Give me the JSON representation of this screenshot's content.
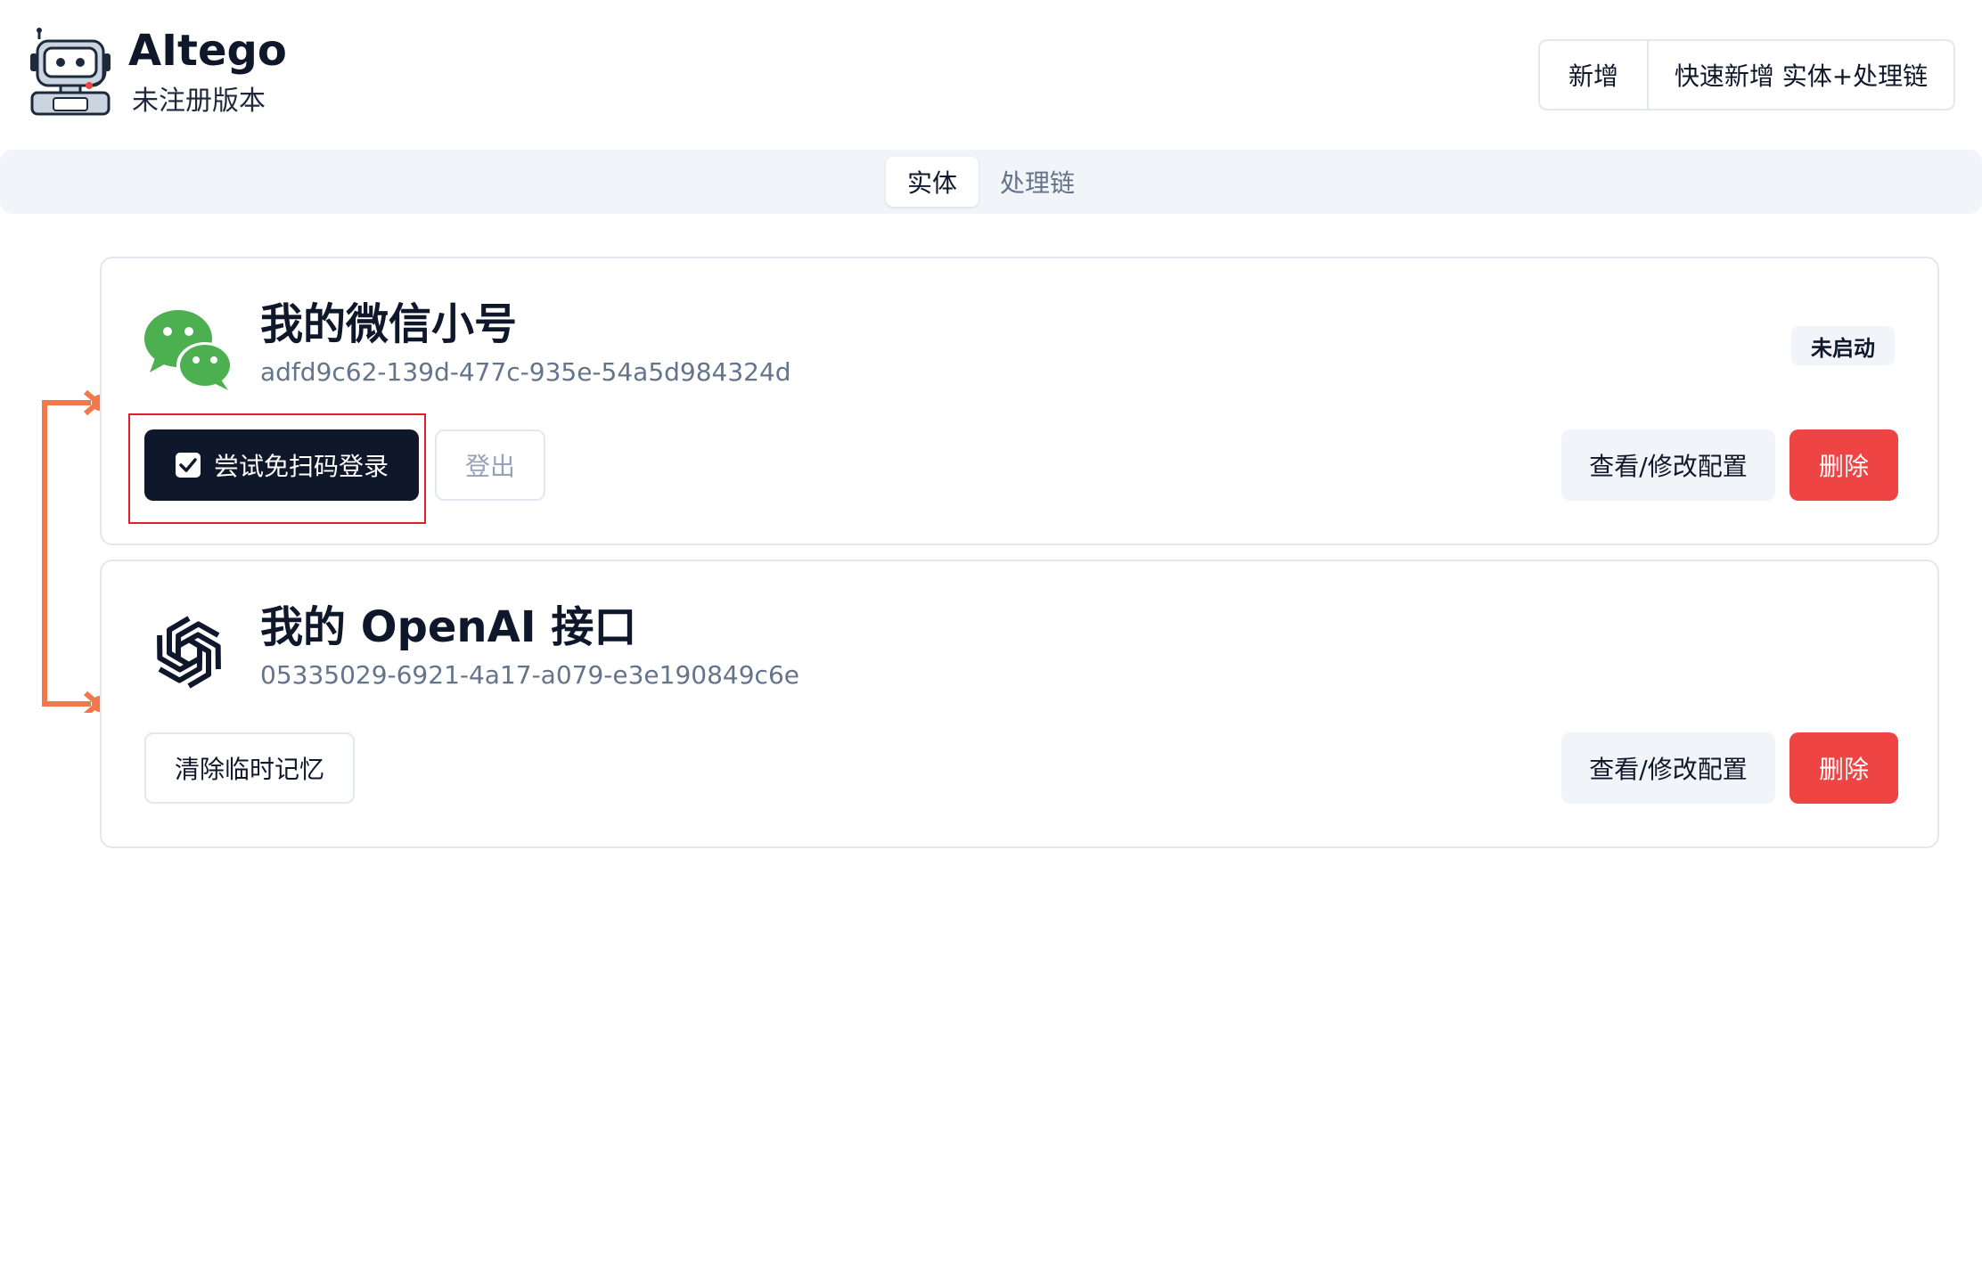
{
  "header": {
    "app_name": "AItego",
    "subtitle": "未注册版本",
    "new_button": "新增",
    "quick_add_button": "快速新增 实体+处理链"
  },
  "tabs": {
    "entity": "实体",
    "chain": "处理链"
  },
  "cards": [
    {
      "title": "我的微信小号",
      "id": "adfd9c62-139d-477c-935e-54a5d984324d",
      "status": "未启动",
      "icon": "wechat-icon",
      "primary_action": "尝试免扫码登录",
      "secondary_action": "登出",
      "config_button": "查看/修改配置",
      "delete_button": "删除"
    },
    {
      "title": "我的 OpenAI 接口",
      "id": "05335029-6921-4a17-a079-e3e190849c6e",
      "icon": "openai-icon",
      "primary_action": "清除临时记忆",
      "config_button": "查看/修改配置",
      "delete_button": "删除"
    }
  ],
  "colors": {
    "primary_dark": "#0f172a",
    "danger": "#ef4444",
    "muted_bg": "#f1f5f9",
    "connector": "#f2784b",
    "wechat_green": "#4caf50",
    "highlight_red": "#e11d2e"
  }
}
